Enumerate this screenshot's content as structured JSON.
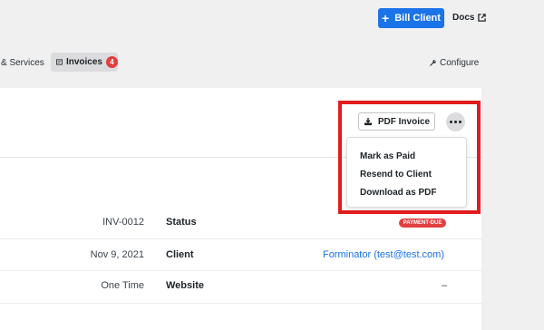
{
  "header": {
    "bill_client_label": "Bill Client",
    "docs_label": "Docs",
    "plus_icon": "plus-icon",
    "external_icon": "external-link-icon"
  },
  "tabs": {
    "services_label": "& Services",
    "invoices_label": "Invoices",
    "invoices_count": "4",
    "configure_label": "Configure"
  },
  "invoice_actions": {
    "pdf_label": "PDF Invoice",
    "menu_items": [
      "Mark as Paid",
      "Resend to Client",
      "Download as PDF"
    ]
  },
  "details": {
    "rows": [
      {
        "value": "INV-0012",
        "label": "Status",
        "detail": "PAYMENT-DUE"
      },
      {
        "value": "Nov 9, 2021",
        "label": "Client",
        "detail": "Forminator (test@test.com)"
      },
      {
        "value": "One Time",
        "label": "Website",
        "detail": "–"
      }
    ]
  },
  "colors": {
    "primary": "#1a73e8",
    "danger": "#e23f3f",
    "highlight": "#e21c1c",
    "background": "#f0f0f1"
  }
}
